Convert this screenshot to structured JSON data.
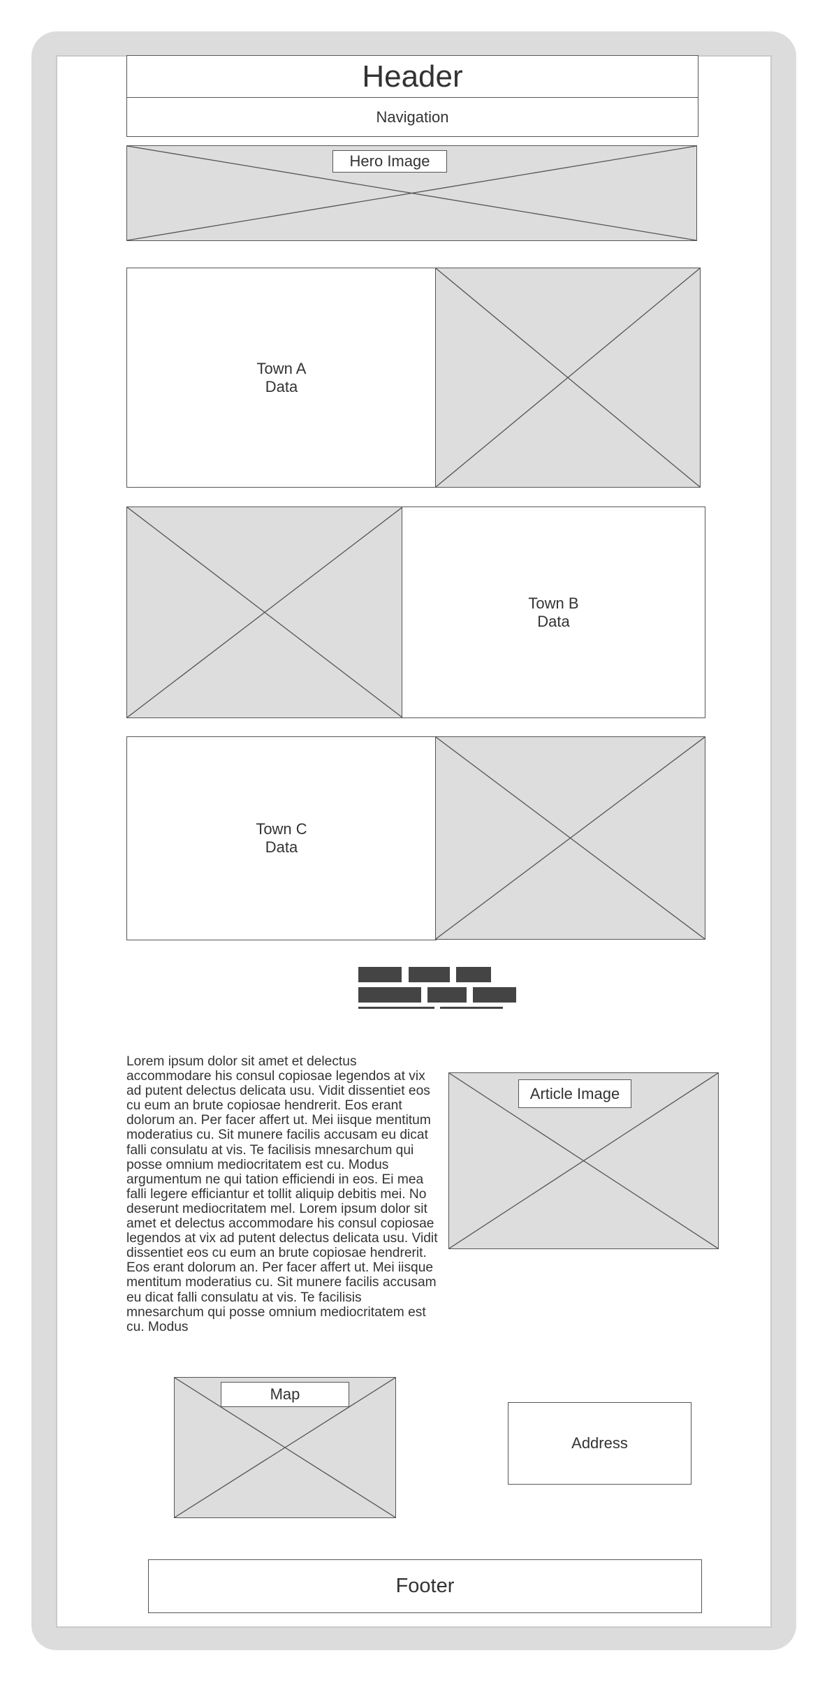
{
  "header": {
    "title": "Header"
  },
  "navigation": {
    "label": "Navigation"
  },
  "hero": {
    "label": "Hero Image"
  },
  "towns": [
    {
      "name": "Town A",
      "sub": "Data"
    },
    {
      "name": "Town B",
      "sub": "Data"
    },
    {
      "name": "Town C",
      "sub": "Data"
    }
  ],
  "article": {
    "text": "Lorem ipsum dolor sit amet et delectus accommodare his consul copiosae legendos at vix ad putent delectus delicata usu. Vidit dissentiet eos cu eum an brute copiosae hendrerit. Eos erant dolorum an. Per facer affert ut. Mei iisque mentitum moderatius cu. Sit munere facilis accusam eu dicat falli consulatu at vis. Te facilisis mnesarchum qui posse omnium mediocritatem est cu. Modus argumentum ne qui tation efficiendi in eos. Ei mea falli legere efficiantur et tollit aliquip debitis mei. No deserunt mediocritatem mel. Lorem ipsum dolor sit amet et delectus accommodare his consul copiosae legendos at vix ad putent delectus delicata usu. Vidit dissentiet eos cu eum an brute copiosae hendrerit. Eos erant dolorum an. Per facer affert ut. Mei iisque mentitum moderatius cu. Sit munere facilis accusam eu dicat falli consulatu at vis. Te facilisis mnesarchum qui posse omnium mediocritatem est cu. Modus",
    "image_label": "Article Image"
  },
  "map": {
    "label": "Map"
  },
  "address": {
    "label": "Address"
  },
  "footer": {
    "label": "Footer"
  },
  "colors": {
    "frame": "#dcdcdc",
    "placeholder": "#dddddd",
    "stroke": "#555555",
    "text": "#333333",
    "button_block": "#444444"
  }
}
